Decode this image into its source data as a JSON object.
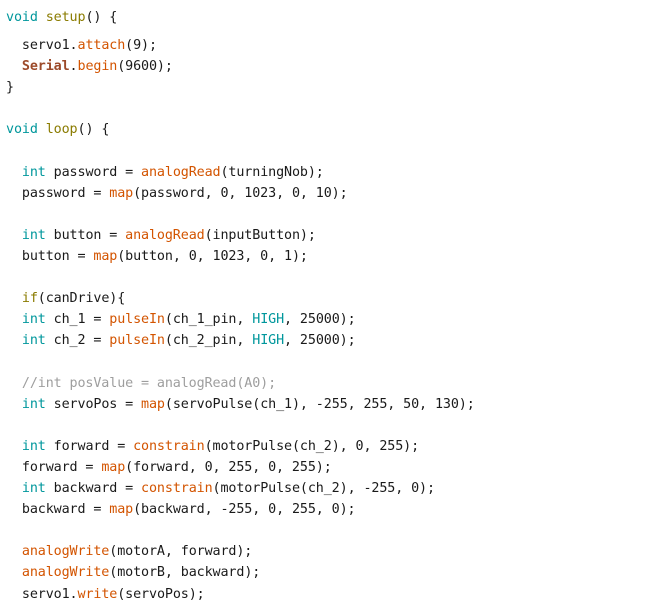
{
  "editor": {
    "language": "arduino-cpp",
    "background_color": "#ffffff",
    "colors": {
      "keyword": "#00979c",
      "control": "#8a7b00",
      "function": "#d35400",
      "object": "#9c4a2a",
      "plain": "#1a1a1a",
      "comment": "#9e9e9e"
    }
  },
  "code": {
    "lines": [
      {
        "id": "l1",
        "text": "void setup() {"
      },
      {
        "id": "l2",
        "text": "  servo1.attach(9);"
      },
      {
        "id": "l3",
        "text": "  Serial.begin(9600);"
      },
      {
        "id": "l4",
        "text": "}"
      },
      {
        "id": "l5",
        "text": ""
      },
      {
        "id": "l6",
        "text": "void loop() {"
      },
      {
        "id": "l7",
        "text": ""
      },
      {
        "id": "l8",
        "text": "  int password = analogRead(turningNob);"
      },
      {
        "id": "l9",
        "text": "  password = map(password, 0, 1023, 0, 10);"
      },
      {
        "id": "l10",
        "text": ""
      },
      {
        "id": "l11",
        "text": "  int button = analogRead(inputButton);"
      },
      {
        "id": "l12",
        "text": "  button = map(button, 0, 1023, 0, 1);"
      },
      {
        "id": "l13",
        "text": ""
      },
      {
        "id": "l14",
        "text": "  if(canDrive){"
      },
      {
        "id": "l15",
        "text": "  int ch_1 = pulseIn(ch_1_pin, HIGH, 25000);"
      },
      {
        "id": "l16",
        "text": "  int ch_2 = pulseIn(ch_2_pin, HIGH, 25000);"
      },
      {
        "id": "l17",
        "text": ""
      },
      {
        "id": "l18",
        "text": "  //int posValue = analogRead(A0);"
      },
      {
        "id": "l19",
        "text": "  int servoPos = map(servoPulse(ch_1), -255, 255, 50, 130);"
      },
      {
        "id": "l20",
        "text": ""
      },
      {
        "id": "l21",
        "text": "  int forward = constrain(motorPulse(ch_2), 0, 255);"
      },
      {
        "id": "l22",
        "text": "  forward = map(forward, 0, 255, 0, 255);"
      },
      {
        "id": "l23",
        "text": "  int backward = constrain(motorPulse(ch_2), -255, 0);"
      },
      {
        "id": "l24",
        "text": "  backward = map(backward, -255, 0, 255, 0);"
      },
      {
        "id": "l25",
        "text": ""
      },
      {
        "id": "l26",
        "text": "  analogWrite(motorA, forward);"
      },
      {
        "id": "l27",
        "text": "  analogWrite(motorB, backward);"
      },
      {
        "id": "l28",
        "text": "  servo1.write(servoPos);"
      }
    ],
    "tokens": {
      "keywords": [
        "void",
        "int",
        "HIGH"
      ],
      "control": [
        "setup",
        "loop",
        "if"
      ],
      "functions": [
        "attach",
        "begin",
        "analogRead",
        "map",
        "pulseIn",
        "constrain",
        "analogWrite",
        "write"
      ],
      "objects": [
        "Serial"
      ],
      "identifiers": [
        "servo1",
        "password",
        "turningNob",
        "button",
        "inputButton",
        "canDrive",
        "ch_1",
        "ch_2",
        "ch_1_pin",
        "ch_2_pin",
        "servoPos",
        "servoPulse",
        "forward",
        "backward",
        "motorPulse",
        "motorA",
        "motorB",
        "posValue",
        "A0"
      ],
      "numbers": [
        "9",
        "9600",
        "0",
        "1023",
        "10",
        "1",
        "25000",
        "255",
        "-255",
        "50",
        "130"
      ],
      "comments": [
        "//int posValue = analogRead(A0);"
      ]
    }
  }
}
